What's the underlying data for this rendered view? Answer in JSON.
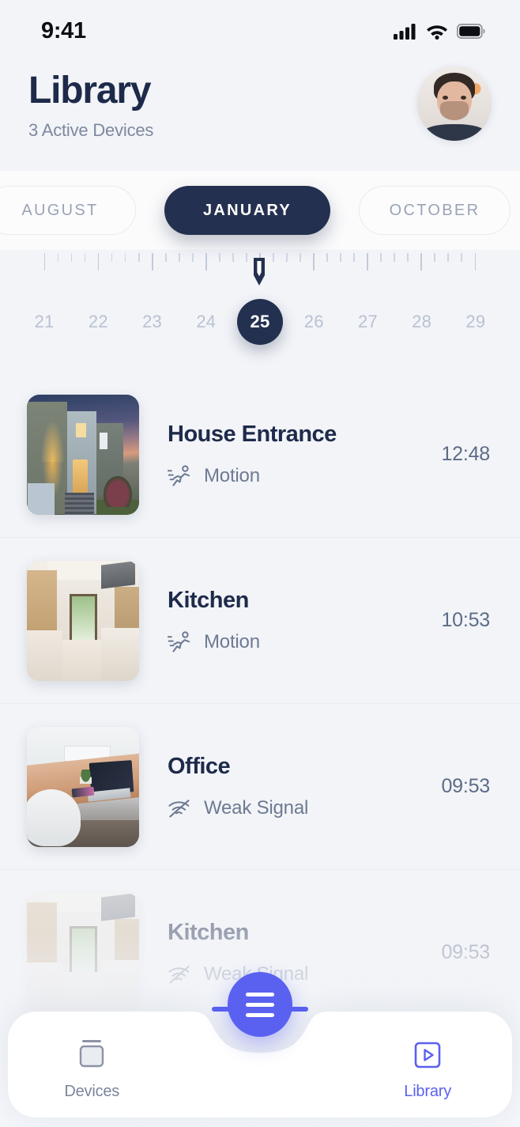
{
  "status_bar": {
    "time": "9:41",
    "cellular_icon": "signal-bars-icon",
    "wifi_icon": "wifi-icon",
    "battery_icon": "battery-full-icon"
  },
  "header": {
    "title": "Library",
    "subtitle": "3 Active Devices",
    "avatar_icon": "user-avatar"
  },
  "months": {
    "tabs": [
      {
        "label": "AUGUST",
        "active": false
      },
      {
        "label": "JANUARY",
        "active": true
      },
      {
        "label": "OCTOBER",
        "active": false
      }
    ]
  },
  "calendar": {
    "days": [
      {
        "num": "21",
        "selected": false
      },
      {
        "num": "22",
        "selected": false
      },
      {
        "num": "23",
        "selected": false
      },
      {
        "num": "24",
        "selected": false
      },
      {
        "num": "25",
        "selected": true
      },
      {
        "num": "26",
        "selected": false
      },
      {
        "num": "27",
        "selected": false
      },
      {
        "num": "28",
        "selected": false
      },
      {
        "num": "29",
        "selected": false
      }
    ],
    "marker_icon": "ruler-pin-icon"
  },
  "events": [
    {
      "title": "House Entrance",
      "status": "Motion",
      "status_icon": "motion-running-icon",
      "time": "12:48",
      "thumbnail": "house-entrance-thumbnail"
    },
    {
      "title": "Kitchen",
      "status": "Motion",
      "status_icon": "motion-running-icon",
      "time": "10:53",
      "thumbnail": "kitchen-thumbnail"
    },
    {
      "title": "Office",
      "status": "Weak Signal",
      "status_icon": "wifi-off-icon",
      "time": "09:53",
      "thumbnail": "office-thumbnail"
    },
    {
      "title": "Kitchen",
      "status": "Weak Signal",
      "status_icon": "wifi-off-icon",
      "time": "09:53",
      "thumbnail": "kitchen-thumbnail"
    }
  ],
  "bottom_nav": {
    "items": [
      {
        "label": "Devices",
        "icon": "devices-monitor-icon",
        "active": false
      },
      {
        "label": "Library",
        "icon": "play-square-icon",
        "active": true
      }
    ],
    "fab_icon": "menu-hamburger-icon"
  },
  "colors": {
    "accent": "#5a61f0",
    "navy": "#24304f",
    "background": "#f2f4f8",
    "muted_text": "#7d889e"
  }
}
